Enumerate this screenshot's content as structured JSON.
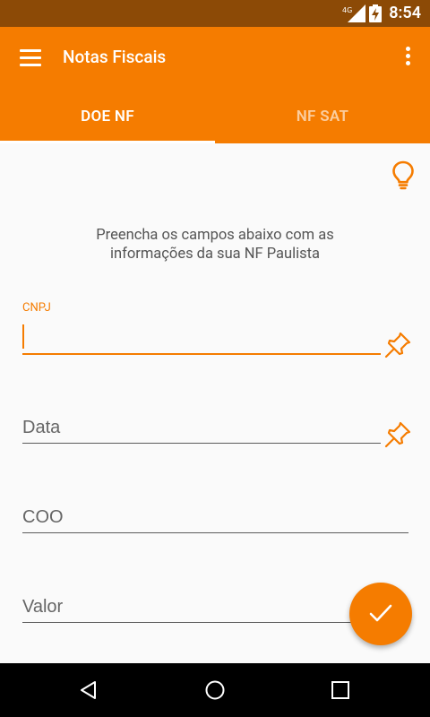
{
  "status_bar": {
    "network": "4G",
    "time": "8:54",
    "icons": [
      "signal-icon",
      "battery-icon"
    ]
  },
  "app_bar": {
    "title": "Notas Fiscais",
    "icons": [
      "menu-icon",
      "more-vert-icon"
    ]
  },
  "tabs": [
    {
      "label": "DOE NF",
      "active": true
    },
    {
      "label": "NF SAT",
      "active": false
    }
  ],
  "instructions": {
    "line1": "Preencha os campos abaixo com as",
    "line2": "informações da sua NF Paulista"
  },
  "form": {
    "cnpj": {
      "label": "CNPJ",
      "value": "",
      "focused": true
    },
    "data": {
      "placeholder": "Data",
      "value": ""
    },
    "coo": {
      "placeholder": "COO",
      "value": ""
    },
    "valor": {
      "placeholder": "Valor",
      "value": ""
    }
  },
  "colors": {
    "accent": "#F57C00",
    "status_bar": "#8C4A06",
    "nav_bar": "#000000",
    "background": "#FAFAFA"
  },
  "nav_bar": {
    "icons": [
      "back-icon",
      "home-icon",
      "recents-icon"
    ]
  }
}
